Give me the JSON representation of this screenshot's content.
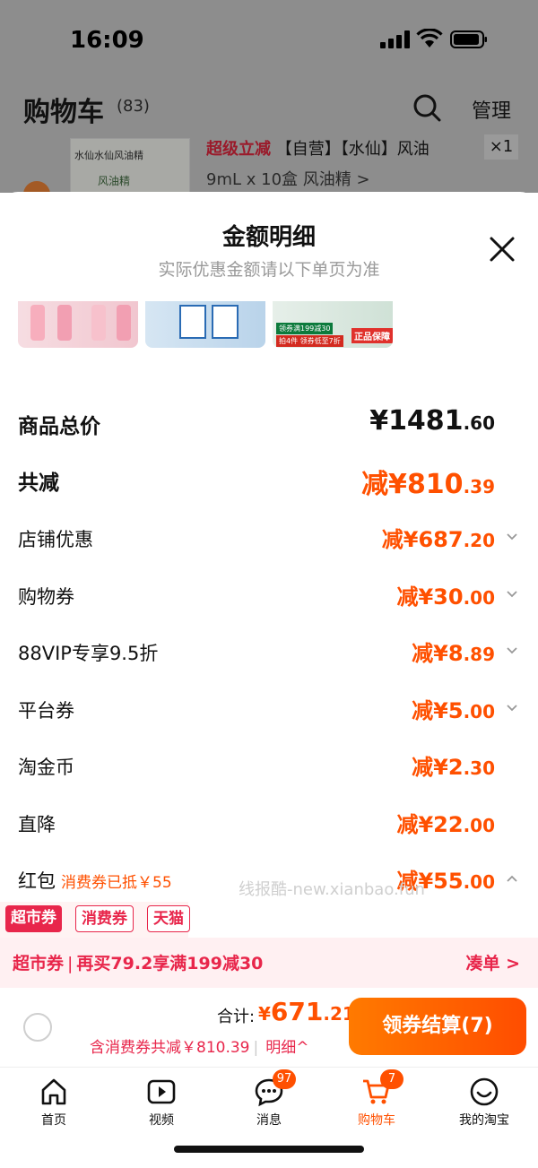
{
  "status_bar": {
    "time": "16:09"
  },
  "background_cart": {
    "title": "购物车",
    "count": "(83)",
    "manage": "管理",
    "product_thumb_line1": "水仙水仙风油精",
    "product_thumb_line2": "风油精",
    "product_red": "超级立减",
    "product_name": "【自营】【水仙】风油",
    "quantity": "×1",
    "spec": "9mL x 10盒 风油精 >"
  },
  "sheet": {
    "title": "金额明细",
    "subtitle": "实际优惠金额请以下单页为准",
    "banner3_line1": "领券满199减30",
    "banner3_line2": "拍4件 领券低至7折",
    "banner3_badge": "正品保障",
    "rows": [
      {
        "label": "商品总价",
        "prefix": "¥",
        "int": "1481",
        "dec": ".60"
      },
      {
        "label": "共减",
        "prefix": "减¥",
        "int": "810",
        "dec": ".39"
      },
      {
        "label": "店铺优惠",
        "prefix": "减¥",
        "int": "687",
        "dec": ".20"
      },
      {
        "label": "购物券",
        "prefix": "减¥",
        "int": "30",
        "dec": ".00"
      },
      {
        "label": "88VIP专享9.5折",
        "prefix": "减¥",
        "int": "8",
        "dec": ".89"
      },
      {
        "label": "平台券",
        "prefix": "减¥",
        "int": "5",
        "dec": ".00"
      },
      {
        "label": "淘金币",
        "prefix": "减¥",
        "int": "2",
        "dec": ".30"
      },
      {
        "label": "直降",
        "prefix": "减¥",
        "int": "22",
        "dec": ".00"
      },
      {
        "label": "红包",
        "note": "消费券已抵￥55",
        "prefix": "减¥",
        "int": "55",
        "dec": ".00"
      }
    ],
    "watermark": "线报酷-new.xianbao.fun"
  },
  "coupon_tags": [
    "超市券",
    "消费券",
    "天猫"
  ],
  "promo": {
    "tag": "超市券",
    "text": "再买79.2享满199减30",
    "action": "凑单 >"
  },
  "checkout": {
    "total_label": "合计:",
    "total_currency": "¥",
    "total_int": "671",
    "total_dec": ".21",
    "sub_text": "含消费券共减￥810.39",
    "detail": "明细^",
    "pay_button": "领券结算(7)"
  },
  "tabbar": {
    "items": [
      {
        "label": "首页",
        "icon": "home-icon"
      },
      {
        "label": "视频",
        "icon": "video-icon"
      },
      {
        "label": "消息",
        "icon": "message-icon",
        "badge": "97"
      },
      {
        "label": "购物车",
        "icon": "cart-icon",
        "badge": "7",
        "active": true
      },
      {
        "label": "我的淘宝",
        "icon": "profile-icon"
      }
    ]
  },
  "colors": {
    "accent": "#ff5000",
    "red": "#e8264b"
  }
}
